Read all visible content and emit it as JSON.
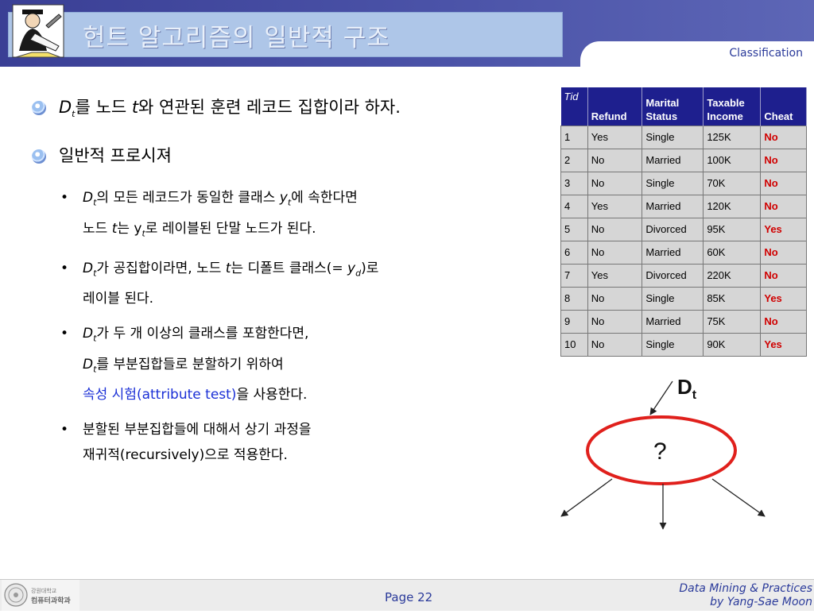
{
  "header": {
    "title": "헌트 알고리즘의 일반적 구조",
    "section_tab": "Classification"
  },
  "content": {
    "point1": {
      "d": "D",
      "sub": "t",
      "a": "를 노드 ",
      "t": "t",
      "b": "와 연관된 훈련 레코드 집합이라 하자."
    },
    "point2": "일반적 프로시져",
    "sub1": {
      "d": "D",
      "sub": "t",
      "a": "의 모든 레코드가 동일한 클래스 ",
      "y": "y",
      "ysub": "t",
      "b": "에 속한다면",
      "c": "노드 ",
      "t": "t",
      "d2": "는 ",
      "y2": "y",
      "y2sub": "t",
      "e": "로 레이블된 단말 노드가 된다."
    },
    "sub2": {
      "d": "D",
      "sub": "t",
      "a": "가 공집합이라면, 노드 ",
      "t": "t",
      "b": "는 디폴트 클래스(= ",
      "y": "y",
      "ysub": "d",
      "c": ")로",
      "e": "레이블 된다."
    },
    "sub3": {
      "d": "D",
      "sub": "t",
      "a": "가 두 개 이상의 클래스를 포함한다면,",
      "d2": "D",
      "sub2": "t",
      "b": "를 부분집합들로 분할하기 위하여",
      "blue": "속성 시험",
      "c": "(attribute test)",
      "e": "을 사용한다."
    },
    "sub4": {
      "a": "분할된 부분집합들에 대해서 상기 과정을",
      "b": "재귀적(recursively)으로 적용한다."
    }
  },
  "table": {
    "headers": [
      "Tid",
      "Refund",
      "Marital\nStatus",
      "Taxable\nIncome",
      "Cheat"
    ],
    "rows": [
      [
        "1",
        "Yes",
        "Single",
        "125K",
        "No"
      ],
      [
        "2",
        "No",
        "Married",
        "100K",
        "No"
      ],
      [
        "3",
        "No",
        "Single",
        "70K",
        "No"
      ],
      [
        "4",
        "Yes",
        "Married",
        "120K",
        "No"
      ],
      [
        "5",
        "No",
        "Divorced",
        "95K",
        "Yes"
      ],
      [
        "6",
        "No",
        "Married",
        "60K",
        "No"
      ],
      [
        "7",
        "Yes",
        "Divorced",
        "220K",
        "No"
      ],
      [
        "8",
        "No",
        "Single",
        "85K",
        "Yes"
      ],
      [
        "9",
        "No",
        "Married",
        "75K",
        "No"
      ],
      [
        "10",
        "No",
        "Single",
        "90K",
        "Yes"
      ]
    ]
  },
  "diagram": {
    "label": "D",
    "label_sub": "t",
    "node": "?",
    "ellipse_color": "#e0201c"
  },
  "footer": {
    "page": "Page 22",
    "course_line1": "Data Mining & Practices",
    "course_line2": "by Yang-Sae Moon",
    "logo_text1": "강원대학교",
    "logo_text2": "컴퓨터과학과"
  },
  "colors": {
    "header_bg": "#3a3f95",
    "title_box": "#aec6e8",
    "table_header": "#1e1f8e",
    "accent_blue": "#2a3a9a"
  }
}
